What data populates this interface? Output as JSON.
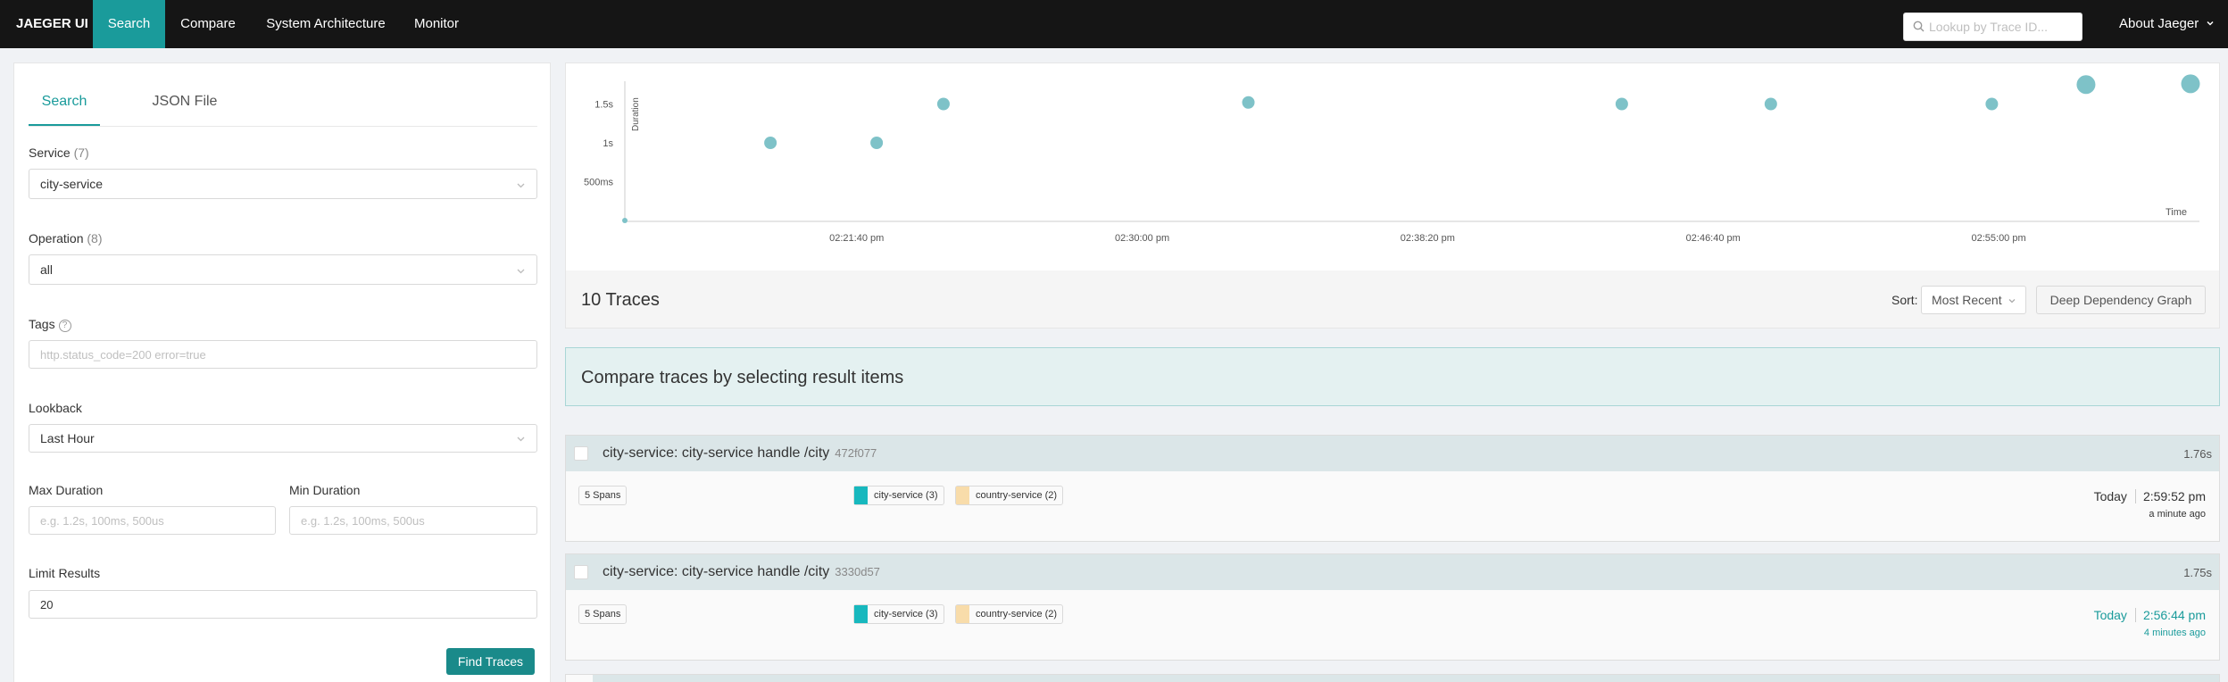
{
  "nav": {
    "brand": "JAEGER UI",
    "items": [
      {
        "label": "Search",
        "active": true
      },
      {
        "label": "Compare",
        "active": false
      },
      {
        "label": "System Architecture",
        "active": false
      },
      {
        "label": "Monitor",
        "active": false
      }
    ],
    "lookup_placeholder": "Lookup by Trace ID...",
    "about": "About Jaeger"
  },
  "search_panel": {
    "tabs": [
      "Search",
      "JSON File"
    ],
    "service": {
      "label": "Service",
      "count": "(7)",
      "value": "city-service"
    },
    "operation": {
      "label": "Operation",
      "count": "(8)",
      "value": "all"
    },
    "tags": {
      "label": "Tags",
      "placeholder": "http.status_code=200 error=true"
    },
    "lookback": {
      "label": "Lookback",
      "value": "Last Hour"
    },
    "max_duration": {
      "label": "Max Duration",
      "placeholder": "e.g. 1.2s, 100ms, 500us"
    },
    "min_duration": {
      "label": "Min Duration",
      "placeholder": "e.g. 1.2s, 100ms, 500us"
    },
    "limit": {
      "label": "Limit Results",
      "value": "20"
    },
    "find_button": "Find Traces"
  },
  "chart_data": {
    "type": "scatter",
    "xlabel": "Time",
    "ylabel": "Duration",
    "y_ticks": [
      {
        "label": "500ms",
        "value": 0.5
      },
      {
        "label": "1s",
        "value": 1.0
      },
      {
        "label": "1.5s",
        "value": 1.5
      }
    ],
    "x_ticks": [
      "02:21:40 pm",
      "02:30:00 pm",
      "02:38:20 pm",
      "02:46:40 pm",
      "02:55:00 pm"
    ],
    "x_tick_minutes": [
      21.667,
      30.0,
      38.333,
      46.667,
      55.0
    ],
    "x_range_minutes": [
      14.9,
      60.5
    ],
    "ylim": [
      0,
      2.0
    ],
    "points": [
      {
        "t_min": 14.9,
        "duration_s": 0.0,
        "spans": 1
      },
      {
        "t_min": 19.15,
        "duration_s": 1.0,
        "spans": 5
      },
      {
        "t_min": 22.25,
        "duration_s": 1.0,
        "spans": 5
      },
      {
        "t_min": 24.2,
        "duration_s": 1.5,
        "spans": 5
      },
      {
        "t_min": 33.1,
        "duration_s": 1.52,
        "spans": 5
      },
      {
        "t_min": 44.0,
        "duration_s": 1.5,
        "spans": 5
      },
      {
        "t_min": 48.35,
        "duration_s": 1.5,
        "spans": 5
      },
      {
        "t_min": 54.8,
        "duration_s": 1.5,
        "spans": 5
      },
      {
        "t_min": 57.55,
        "duration_s": 1.75,
        "spans": 8
      },
      {
        "t_min": 60.6,
        "duration_s": 1.76,
        "spans": 8
      }
    ],
    "point_color": "#7ec2c8"
  },
  "results": {
    "count_label": "10 Traces",
    "sort_label": "Sort:",
    "sort_value": "Most Recent",
    "ddg_button": "Deep Dependency Graph",
    "compare_text": "Compare traces by selecting result items",
    "traces": [
      {
        "title": "city-service: city-service handle /city",
        "id": "472f077",
        "duration": "1.76s",
        "spans": "5 Spans",
        "services": [
          {
            "label": "city-service (3)",
            "color": "#17b8be"
          },
          {
            "label": "country-service (2)",
            "color": "#f8dcaa"
          }
        ],
        "day": "Today",
        "time": "2:59:52 pm",
        "ago": "a minute ago"
      },
      {
        "title": "city-service: city-service handle /city",
        "id": "3330d57",
        "duration": "1.75s",
        "spans": "5 Spans",
        "services": [
          {
            "label": "city-service (3)",
            "color": "#17b8be"
          },
          {
            "label": "country-service (2)",
            "color": "#f8dcaa"
          }
        ],
        "day": "Today",
        "time": "2:56:44 pm",
        "ago": "4 minutes ago"
      }
    ]
  }
}
